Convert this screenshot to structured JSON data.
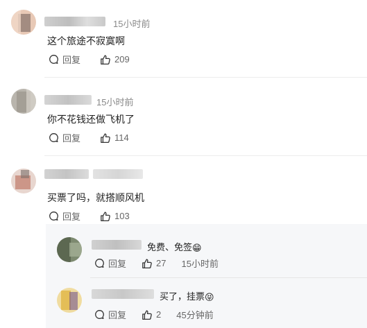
{
  "comments": [
    {
      "time": "15小时前",
      "text": "这个旅途不寂寞啊",
      "reply_label": "回复",
      "likes": "209",
      "avatar_colors": [
        "#e8c9b6",
        "#6a5a55",
        "#d9b7a3"
      ]
    },
    {
      "time": "15小时前",
      "text": "你不花钱还做飞机了",
      "reply_label": "回复",
      "likes": "114",
      "avatar_colors": [
        "#b9b5ad",
        "#8f8a80",
        "#d8d4cc"
      ]
    },
    {
      "time": "",
      "text": "买票了吗，就搭顺风机",
      "reply_label": "回复",
      "likes": "103",
      "avatar_colors": [
        "#c07a6a",
        "#7b6f6a",
        "#e8d6cf"
      ]
    }
  ],
  "replies": [
    {
      "text": "免费、免签",
      "emoji": "😁",
      "reply_label": "回复",
      "likes": "27",
      "time": "15小时前",
      "avatar_colors": [
        "#4f5a45",
        "#7d8a70",
        "#a8b39a"
      ]
    },
    {
      "text": "买了，挂票",
      "emoji": "😝",
      "reply_label": "回复",
      "likes": "2",
      "time": "45分钟前",
      "avatar_colors": [
        "#e2b84a",
        "#6a4a8a",
        "#f0dca0"
      ]
    }
  ],
  "colors": {
    "name_blur": "#d6d6d6",
    "reply_bg": "#f6f7f9"
  }
}
